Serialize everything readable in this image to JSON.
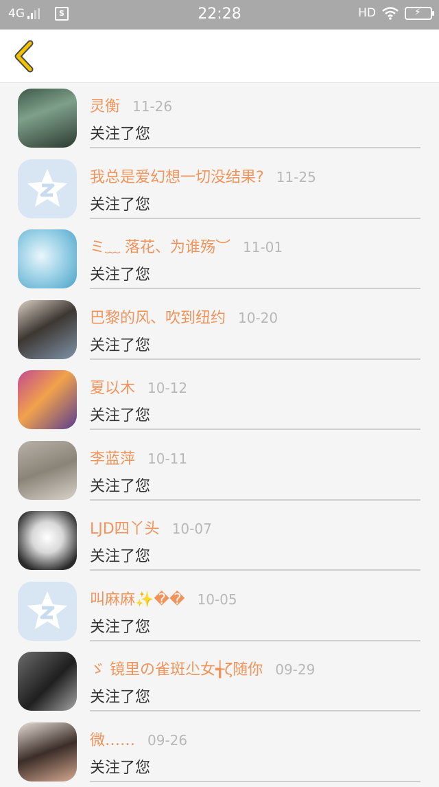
{
  "status_bar": {
    "network": "4G",
    "time": "22:28",
    "hd": "HD"
  },
  "nav": {
    "back_icon": "chevron-left-icon"
  },
  "notifications": [
    {
      "name": "灵衡",
      "date": "11-26",
      "action": "关注了您",
      "avatar": "photo"
    },
    {
      "name": "我总是爱幻想一切没结果?",
      "date": "11-25",
      "action": "关注了您",
      "avatar": "default"
    },
    {
      "name": "ミ﹏ 落花、为谁殇︶",
      "date": "11-01",
      "action": "关注了您",
      "avatar": "photo"
    },
    {
      "name": "巴黎的风、吹到纽约",
      "date": "10-20",
      "action": "关注了您",
      "avatar": "photo"
    },
    {
      "name": "夏以木",
      "date": "10-12",
      "action": "关注了您",
      "avatar": "photo"
    },
    {
      "name": "李蓝萍",
      "date": "10-11",
      "action": "关注了您",
      "avatar": "photo"
    },
    {
      "name": "LJD四丫头",
      "date": "10-07",
      "action": "关注了您",
      "avatar": "photo"
    },
    {
      "name": "叫麻麻✨��",
      "date": "10-05",
      "action": "关注了您",
      "avatar": "default"
    },
    {
      "name": "ゞ 镜里の雀斑尐女╅ζ随你",
      "date": "09-29",
      "action": "关注了您",
      "avatar": "photo"
    },
    {
      "name": "微……",
      "date": "09-26",
      "action": "关注了您",
      "avatar": "photo"
    }
  ],
  "colors": {
    "name": "#f0945c",
    "date": "#b8b8b8",
    "back_icon": "#f2c200"
  }
}
